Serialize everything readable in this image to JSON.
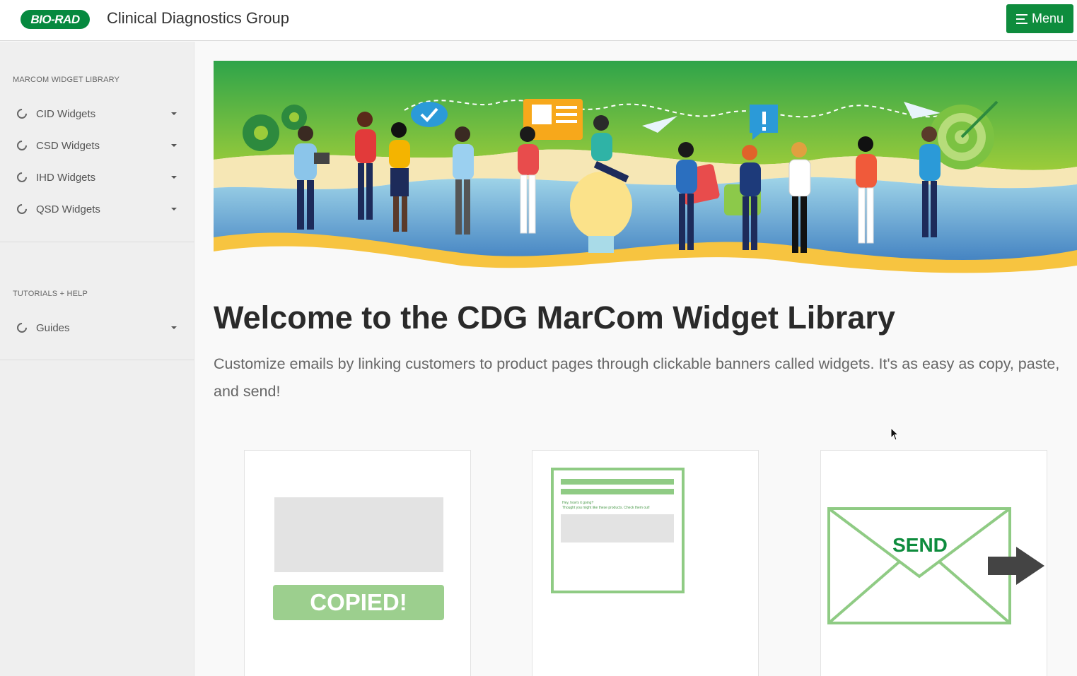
{
  "header": {
    "logo_text": "BIO-RAD",
    "title": "Clinical Diagnostics Group",
    "menu_label": "Menu"
  },
  "sidebar": {
    "sections": [
      {
        "heading": "MARCOM WIDGET LIBRARY",
        "items": [
          {
            "label": "CID Widgets"
          },
          {
            "label": "CSD Widgets"
          },
          {
            "label": "IHD Widgets"
          },
          {
            "label": "QSD Widgets"
          }
        ]
      },
      {
        "heading": "TUTORIALS + HELP",
        "items": [
          {
            "label": "Guides"
          }
        ]
      }
    ]
  },
  "main": {
    "heading": "Welcome to the CDG MarCom Widget Library",
    "intro": "Customize emails by linking customers to product pages through clickable banners called widgets. It's as easy as copy, paste, and send!",
    "cards": [
      {
        "caption": "COPIED!"
      },
      {
        "email_line1": "Hey, how's it going?",
        "email_line2": "Thought you might like these products. Check them out!"
      },
      {
        "caption": "SEND"
      }
    ]
  },
  "colors": {
    "brand_green": "#0e8c3d",
    "light_green": "#9ccf8e",
    "outline_green": "#8fcb84"
  }
}
